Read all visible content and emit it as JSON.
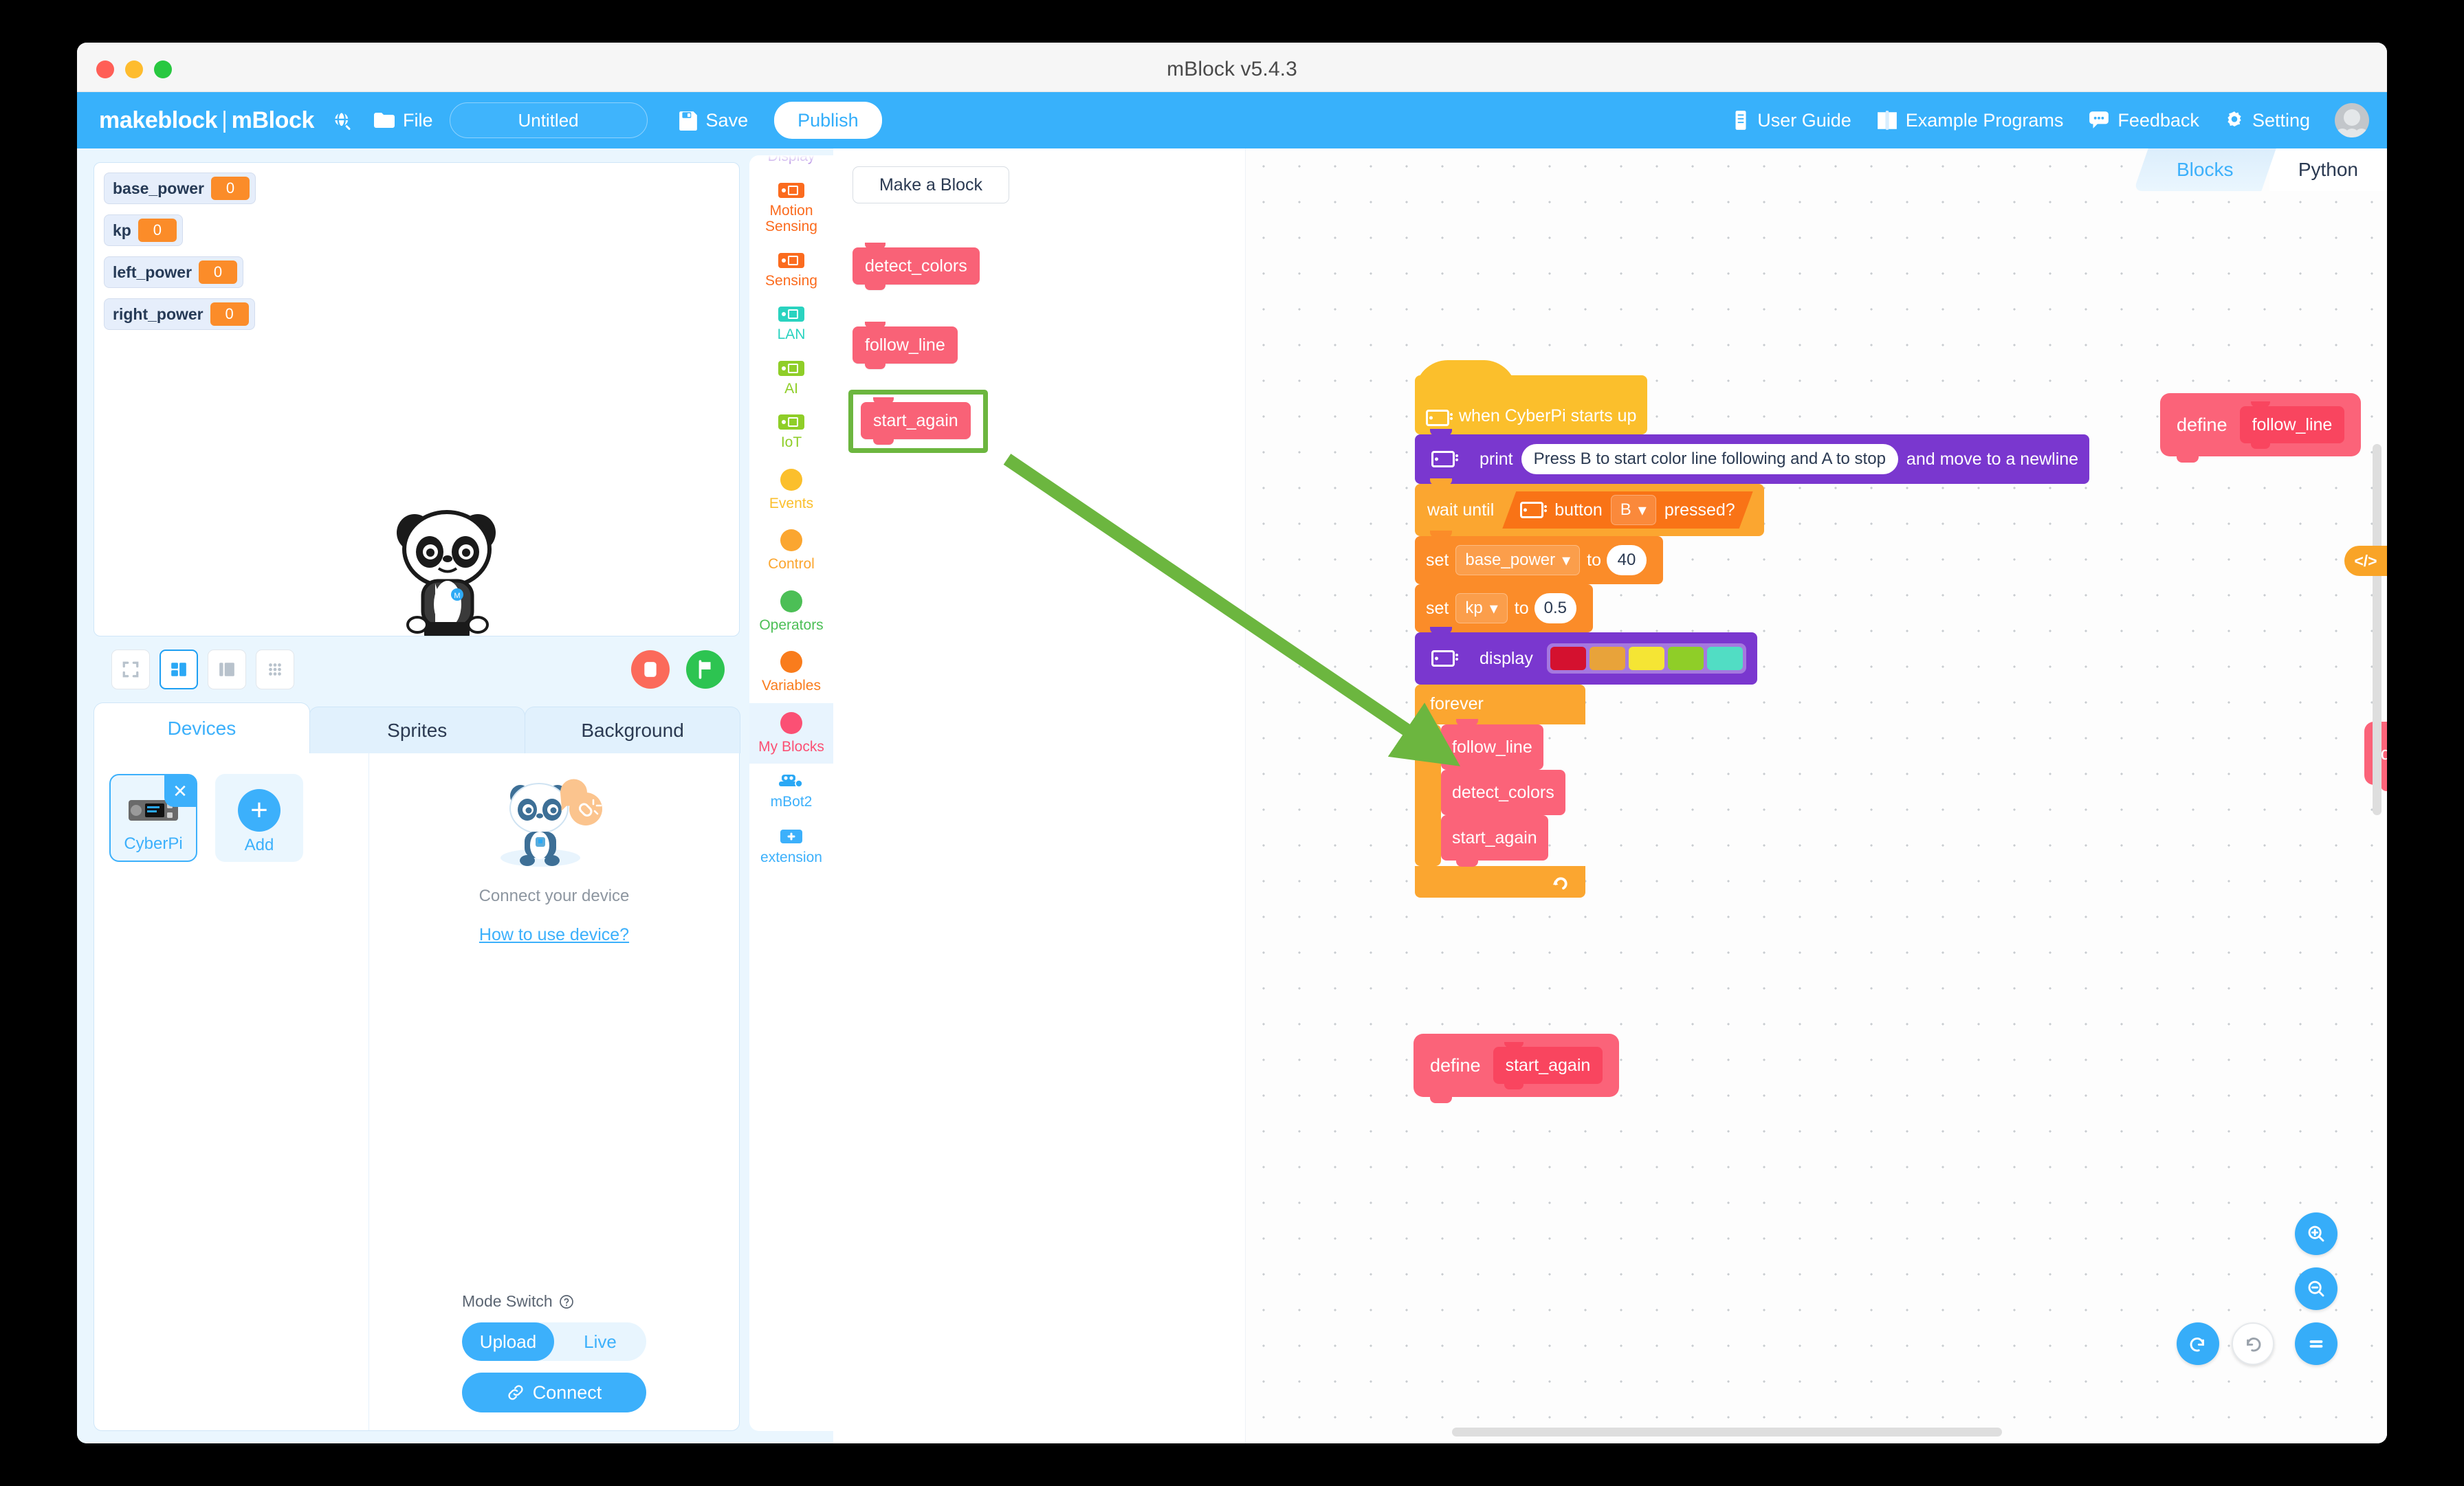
{
  "window": {
    "title": "mBlock v5.4.3"
  },
  "toolbar": {
    "brand_left": "makeblock",
    "brand_sep": "|",
    "brand_right": "mBlock",
    "globe_icon": "globe-icon",
    "file_label": "File",
    "project_name": "Untitled",
    "project_placeholder": "Untitled",
    "save_label": "Save",
    "publish_label": "Publish",
    "right_items": [
      {
        "label": "User Guide",
        "icon": "book-icon"
      },
      {
        "label": "Example Programs",
        "icon": "open-book-icon"
      },
      {
        "label": "Feedback",
        "icon": "chat-icon"
      },
      {
        "label": "Setting",
        "icon": "gear-icon"
      }
    ]
  },
  "stage": {
    "monitors": [
      {
        "name": "base_power",
        "value": "0"
      },
      {
        "name": "kp",
        "value": "0"
      },
      {
        "name": "left_power",
        "value": "0"
      },
      {
        "name": "right_power",
        "value": "0"
      }
    ],
    "sprite_name": "panda-sprite",
    "controls": {
      "fullscreen_icon": "fullscreen-icon",
      "layout_small_icon": "layout-small-stage-icon",
      "layout_large_icon": "layout-large-stage-icon",
      "grid_icon": "grid-layout-icon",
      "stop_icon": "stop-icon",
      "go_icon": "green-flag-icon"
    },
    "monitor_value_color": "#fb8c29"
  },
  "panel": {
    "tabs": [
      {
        "label": "Devices",
        "active": true
      },
      {
        "label": "Sprites",
        "active": false
      },
      {
        "label": "Background",
        "active": false
      }
    ],
    "devices": [
      {
        "label": "CyberPi",
        "selected": true
      },
      {
        "label": "Add",
        "selected": false
      }
    ],
    "connect": {
      "title": "Connect your device",
      "how_to_link": "How to use device?",
      "mode_label": "Mode Switch",
      "mode_help_icon": "help-circle-icon",
      "mode_options": [
        {
          "label": "Upload",
          "active": true
        },
        {
          "label": "Live",
          "active": false
        }
      ],
      "connect_button": "Connect",
      "connect_icon": "link-icon"
    }
  },
  "categories": [
    {
      "label": "Display",
      "color": "#7a37cf",
      "shape": "chip",
      "active": false,
      "partial": true
    },
    {
      "label": "Motion Sensing",
      "color": "#fb6b1e",
      "shape": "chip",
      "active": false
    },
    {
      "label": "Sensing",
      "color": "#fb6b1e",
      "shape": "chip",
      "active": false
    },
    {
      "label": "LAN",
      "color": "#2ad3c0",
      "shape": "chip",
      "active": false
    },
    {
      "label": "AI",
      "color": "#8fce28",
      "shape": "chip",
      "active": false
    },
    {
      "label": "IoT",
      "color": "#8fce28",
      "shape": "chip",
      "active": false
    },
    {
      "label": "Events",
      "color": "#fbbf2c",
      "shape": "dot",
      "active": false
    },
    {
      "label": "Control",
      "color": "#fba630",
      "shape": "dot",
      "active": false
    },
    {
      "label": "Operators",
      "color": "#4cbf56",
      "shape": "dot",
      "active": false
    },
    {
      "label": "Variables",
      "color": "#f97c1c",
      "shape": "dot",
      "active": false
    },
    {
      "label": "My Blocks",
      "color": "#fb5074",
      "shape": "dot",
      "active": true
    },
    {
      "label": "mBot2",
      "color": "#3cb0fb",
      "shape": "robot",
      "active": false
    },
    {
      "label": "extension",
      "color": "#3cb0fb",
      "shape": "plus",
      "active": false
    }
  ],
  "palette": {
    "make_block_label": "Make a Block",
    "blocks": [
      {
        "label": "detect_colors",
        "highlighted": false
      },
      {
        "label": "follow_line",
        "highlighted": false
      },
      {
        "label": "start_again",
        "highlighted": true
      }
    ],
    "highlight_color": "#6cb63f"
  },
  "workspace": {
    "tabs": [
      {
        "label": "Blocks",
        "active": true
      },
      {
        "label": "Python",
        "active": false
      }
    ],
    "code_toggle_label": "</>",
    "script": {
      "hat": {
        "label": "when CyberPi starts up",
        "icon": "cyberpi-icon",
        "color": "#fbbf2c"
      },
      "print": {
        "label": "print",
        "text_value": "Press B to start color line following and A to stop",
        "suffix": "and move to a newline",
        "icon": "cyberpi-icon",
        "color": "#7a37cf"
      },
      "wait_until": {
        "label": "wait until",
        "condition_label": "button",
        "condition_value": "B",
        "condition_suffix": "pressed?",
        "icon": "cyberpi-icon",
        "color": "#fba630"
      },
      "set_base_power": {
        "label": "set",
        "variable": "base_power",
        "to": "to",
        "value": "40",
        "color": "#fb8c29"
      },
      "set_kp": {
        "label": "set",
        "variable": "kp",
        "to": "to",
        "value": "0.5",
        "color": "#fb8c29"
      },
      "display": {
        "label": "display",
        "icon": "cyberpi-icon",
        "color": "#7a37cf",
        "colors": [
          "#d4112f",
          "#e8a33a",
          "#f5e534",
          "#8fce28",
          "#51ddc4"
        ]
      },
      "forever": {
        "label": "forever",
        "color": "#fba630",
        "loop_icon": "loop-arrow-icon"
      },
      "forever_children": [
        "follow_line",
        "detect_colors",
        "start_again"
      ]
    },
    "definitions": [
      {
        "define_label": "define",
        "name": "start_again"
      },
      {
        "define_label": "define",
        "name": "follow_line"
      },
      {
        "define_label": "define",
        "name": "detect_colors"
      }
    ],
    "zoom_controls": {
      "zoom_in_icon": "zoom-in-icon",
      "zoom_out_icon": "zoom-out-icon",
      "zoom_reset_icon": "equals-icon",
      "undo_icon": "undo-icon",
      "redo_icon": "redo-icon"
    }
  }
}
